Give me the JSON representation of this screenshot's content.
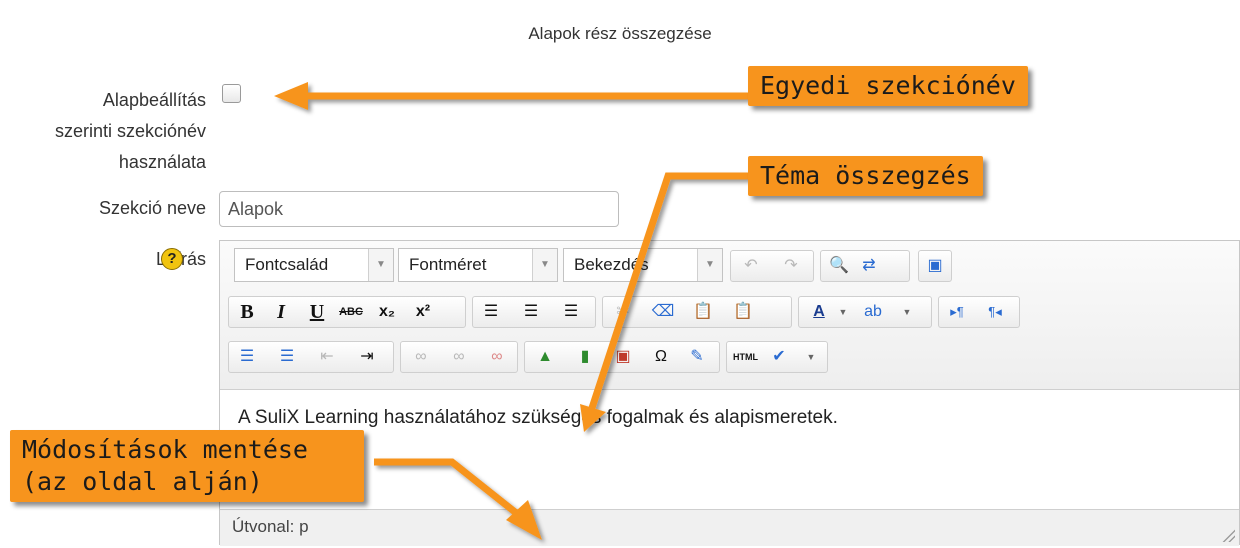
{
  "section_heading": "Alapok rész összegzése",
  "form": {
    "default_name_label": "Alapbeállítás szerinti szekciónév használata",
    "default_name_lines": [
      "Alapbeállítás",
      "szerinti szekciónév",
      "használata"
    ],
    "section_name_label": "Szekció neve",
    "section_name_value": "Alapok",
    "description_label": "Leírás"
  },
  "editor": {
    "font_family": "Fontcsalád",
    "font_size": "Fontméret",
    "paragraph": "Bekezdés",
    "content_text": "A SuliX Learning használatához szükséges fogalmak és alapismeretek.",
    "status_path": "Útvonal: p"
  },
  "callouts": {
    "custom_name": "Egyedi szekciónév",
    "topic_summary": "Téma összegzés",
    "save_changes": "Módosítások mentése (az oldal alján)"
  },
  "colors": {
    "callout": "#f7941d",
    "help": "#f1c40f"
  }
}
